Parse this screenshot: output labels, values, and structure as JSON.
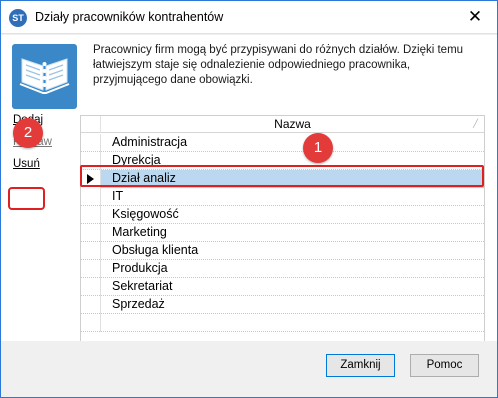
{
  "window": {
    "title": "Działy pracowników kontrahentów",
    "app_icon_text": "ST",
    "close_glyph": "✕"
  },
  "description": "Pracownicy firm mogą być przypisywani do różnych działów. Dzięki temu łatwiejszym staje się odnalezienie odpowiedniego pracownika, przyjmującego dane obowiązki.",
  "sidebar": {
    "add_label": "Dodaj",
    "edit_label": "Popraw",
    "delete_label": "Usuń"
  },
  "grid": {
    "column_header": "Nazwa",
    "rows": [
      "Administracja",
      "Dyrekcja",
      "Dział analiz",
      "IT",
      "Księgowość",
      "Marketing",
      "Obsługa klienta",
      "Produkcja",
      "Sekretariat",
      "Sprzedaż",
      ""
    ],
    "selected_row": 2
  },
  "badges": {
    "one": "1",
    "two": "2"
  },
  "footer": {
    "close_label": "Zamknij",
    "help_label": "Pomoc"
  },
  "colors": {
    "selection": "#bcd8f0",
    "highlight": "#e02020",
    "badge": "#e33a3a"
  }
}
